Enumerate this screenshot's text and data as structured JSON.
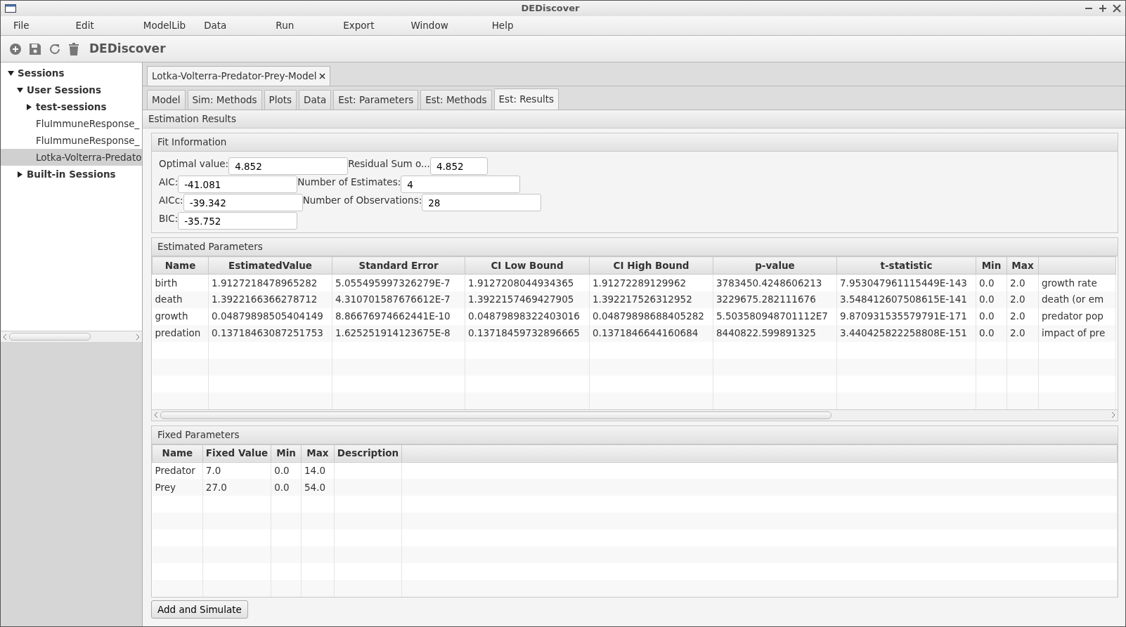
{
  "window": {
    "title": "DEDiscover"
  },
  "menu": [
    "File",
    "Edit",
    "ModelLib",
    "Data",
    "Run",
    "Export",
    "Window",
    "Help"
  ],
  "toolbar": {
    "title": "DEDiscover"
  },
  "sidebar": {
    "items": [
      {
        "label": "Sessions",
        "kind": "folder",
        "expanded": true,
        "selected": false,
        "children": [
          {
            "label": "User Sessions",
            "kind": "folder",
            "expanded": true,
            "selected": false,
            "children": [
              {
                "label": "test-sessions",
                "kind": "folder",
                "expanded": false,
                "selected": false
              },
              {
                "label": "FluImmuneResponse_",
                "kind": "session",
                "selected": false
              },
              {
                "label": "FluImmuneResponse_",
                "kind": "session",
                "selected": false
              },
              {
                "label": "Lotka-Volterra-Predato",
                "kind": "session",
                "selected": true
              }
            ]
          },
          {
            "label": "Built-in Sessions",
            "kind": "folder",
            "expanded": false,
            "selected": false
          }
        ]
      }
    ]
  },
  "document_tabs": [
    {
      "label": "Lotka-Volterra-Predator-Prey-Model",
      "selected": true
    }
  ],
  "tabs": [
    {
      "label": "Model",
      "selected": false
    },
    {
      "label": "Sim: Methods",
      "selected": false
    },
    {
      "label": "Plots",
      "selected": false
    },
    {
      "label": "Data",
      "selected": false
    },
    {
      "label": "Est: Parameters",
      "selected": false
    },
    {
      "label": "Est: Methods",
      "selected": false
    },
    {
      "label": "Est: Results",
      "selected": true
    }
  ],
  "section_title": "Estimation Results",
  "fit_information": {
    "title": "Fit Information",
    "rows": [
      [
        {
          "label": "Optimal value:",
          "value": "4.852"
        },
        {
          "label": "Residual Sum o...",
          "value": "4.852"
        }
      ],
      [
        {
          "label": "AIC:",
          "value": "-41.081"
        },
        {
          "label": "Number of Estimates:",
          "value": "4"
        }
      ],
      [
        {
          "label": "AICc:",
          "value": "-39.342"
        },
        {
          "label": "Number of Observations:",
          "value": "28"
        }
      ],
      [
        {
          "label": "BIC:",
          "value": "-35.752"
        }
      ]
    ]
  },
  "estimated_parameters": {
    "title": "Estimated Parameters",
    "columns": [
      "Name",
      "EstimatedValue",
      "Standard Error",
      "CI Low Bound",
      "CI High Bound",
      "p-value",
      "t-statistic",
      "Min",
      "Max"
    ],
    "rows": [
      [
        "birth",
        "1.9127218478965282",
        "5.055495997326279E-7",
        "1.9127208044934365",
        "1.91272289129962",
        "3783450.4248606213",
        "7.953047961115449E-143",
        "0.0",
        "2.0",
        "growth rate"
      ],
      [
        "death",
        "1.3922166366278712",
        "4.310701587676612E-7",
        "1.3922157469427905",
        "1.392217526312952",
        "3229675.282111676",
        "3.548412607508615E-141",
        "0.0",
        "2.0",
        "death (or em"
      ],
      [
        "growth",
        "0.04879898505404149",
        "8.86676974662441E-10",
        "0.04879898322403016",
        "0.04879898688405282",
        "5.503580948701112E7",
        "9.870931535579791E-171",
        "0.0",
        "2.0",
        "predator pop"
      ],
      [
        "predation",
        "0.13718463087251753",
        "1.625251914123675E-8",
        "0.13718459732896665",
        "0.1371846644160684",
        "8440822.599891325",
        "3.440425822258808E-151",
        "0.0",
        "2.0",
        "impact of pre"
      ]
    ]
  },
  "fixed_parameters": {
    "title": "Fixed Parameters",
    "columns": [
      "Name",
      "Fixed Value",
      "Min",
      "Max",
      "Description"
    ],
    "rows": [
      [
        "Predator",
        "7.0",
        "0.0",
        "14.0"
      ],
      [
        "Prey",
        "27.0",
        "0.0",
        "54.0"
      ]
    ]
  },
  "buttons": [
    "Add and Simulate"
  ]
}
